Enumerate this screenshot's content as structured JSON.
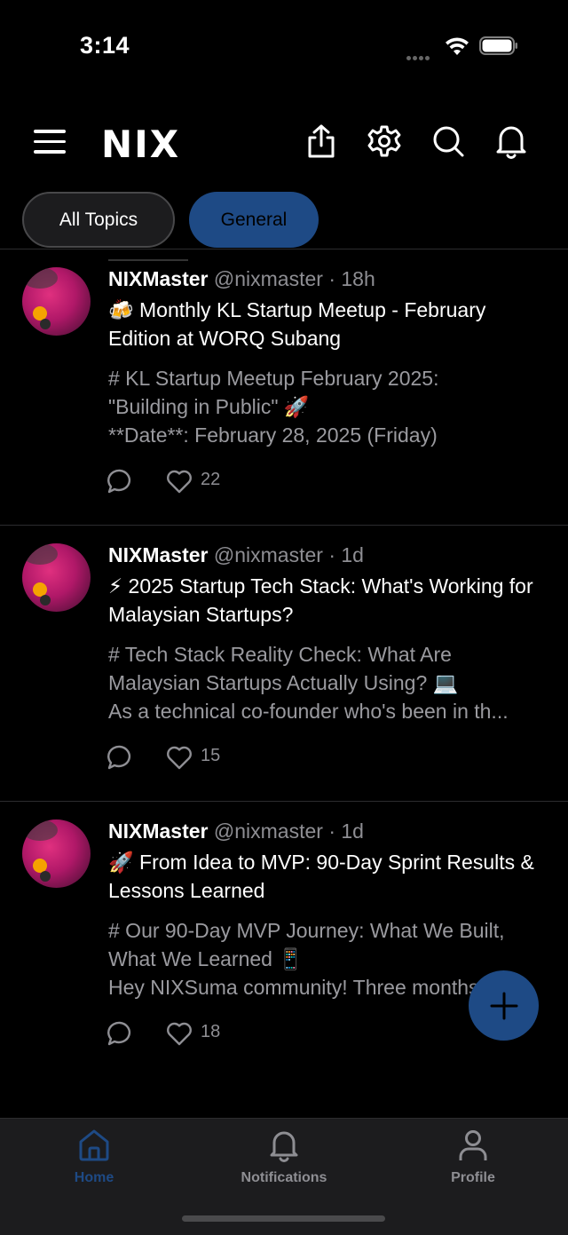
{
  "status_bar": {
    "time": "3:14"
  },
  "header": {
    "logo": "NIX",
    "icons": [
      "menu-icon",
      "share-icon",
      "gear-icon",
      "search-icon",
      "bell-icon"
    ]
  },
  "topics": [
    {
      "label": "All Topics",
      "selected": false
    },
    {
      "label": "General",
      "selected": true
    }
  ],
  "posts": [
    {
      "author": "NIXMaster",
      "handle": "@nixmaster",
      "time": "· 18h",
      "title": "🍻 Monthly KL Startup Meetup - February Edition at WORQ Subang",
      "body": [
        "# KL Startup Meetup February 2025:",
        "\"Building in Public\" 🚀",
        "**Date**: February 28, 2025 (Friday)"
      ],
      "likes": "22"
    },
    {
      "author": "NIXMaster",
      "handle": "@nixmaster",
      "time": "· 1d",
      "title": "⚡ 2025 Startup Tech Stack: What's Working for Malaysian Startups?",
      "body": [
        "# Tech Stack Reality Check: What Are",
        "Malaysian Startups Actually Using? 💻",
        "As a technical co-founder who's been in th..."
      ],
      "likes": "15"
    },
    {
      "author": "NIXMaster",
      "handle": "@nixmaster",
      "time": "· 1d",
      "title": "🚀 From Idea to MVP: 90-Day Sprint Results & Lessons Learned",
      "body": [
        "# Our 90-Day MVP Journey: What We Built,",
        "What We Learned 📱",
        "Hey NIXSuma community! Three months..."
      ],
      "likes": "18"
    }
  ],
  "fab": {
    "icon": "plus-icon"
  },
  "tabbar": {
    "home": "Home",
    "notifications": "Notifications",
    "profile": "Profile"
  },
  "colors": {
    "accent": "#1e4a85",
    "active_tab": "#1e4a85",
    "inactive_tab": "#8e8e93",
    "background": "#000000"
  }
}
